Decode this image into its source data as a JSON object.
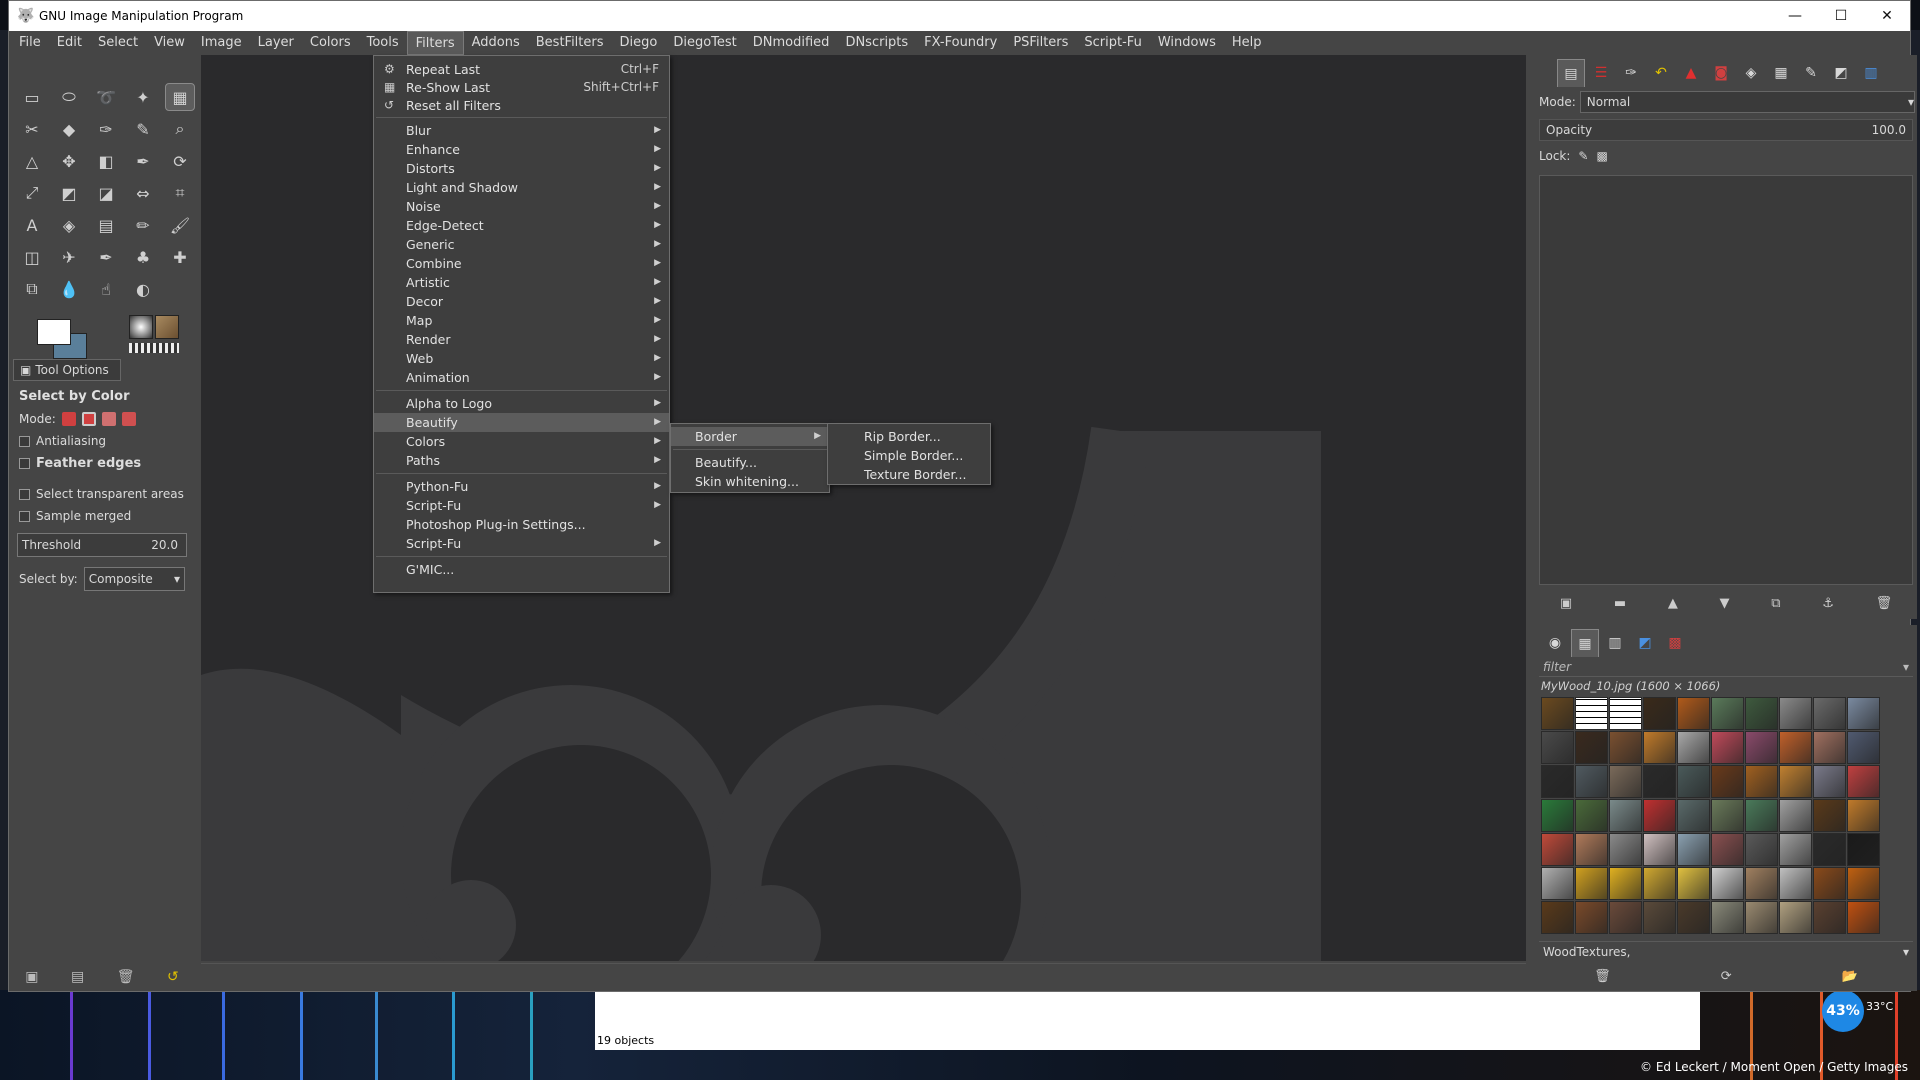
{
  "window": {
    "title": "GNU Image Manipulation Program",
    "controls": {
      "minimize": "—",
      "maximize": "☐",
      "close": "✕"
    }
  },
  "menubar": [
    {
      "label": "File"
    },
    {
      "label": "Edit"
    },
    {
      "label": "Select"
    },
    {
      "label": "View"
    },
    {
      "label": "Image"
    },
    {
      "label": "Layer"
    },
    {
      "label": "Colors"
    },
    {
      "label": "Tools"
    },
    {
      "label": "Filters"
    },
    {
      "label": "Addons"
    },
    {
      "label": "BestFilters"
    },
    {
      "label": "Diego"
    },
    {
      "label": "DiegoTest"
    },
    {
      "label": "DNmodified"
    },
    {
      "label": "DNscripts"
    },
    {
      "label": "FX-Foundry"
    },
    {
      "label": "PSFilters"
    },
    {
      "label": "Script-Fu"
    },
    {
      "label": "Windows"
    },
    {
      "label": "Help"
    }
  ],
  "filters_menu": {
    "top": [
      {
        "label": "Repeat Last",
        "shortcut": "Ctrl+F",
        "icon": "⚙"
      },
      {
        "label": "Re-Show Last",
        "shortcut": "Shift+Ctrl+F",
        "icon": "▦"
      },
      {
        "label": "Reset all Filters",
        "shortcut": "",
        "icon": "↺"
      }
    ],
    "groups": [
      {
        "label": "Blur"
      },
      {
        "label": "Enhance"
      },
      {
        "label": "Distorts"
      },
      {
        "label": "Light and Shadow"
      },
      {
        "label": "Noise"
      },
      {
        "label": "Edge-Detect"
      },
      {
        "label": "Generic"
      },
      {
        "label": "Combine"
      },
      {
        "label": "Artistic"
      },
      {
        "label": "Decor"
      },
      {
        "label": "Map"
      },
      {
        "label": "Render"
      },
      {
        "label": "Web"
      },
      {
        "label": "Animation"
      }
    ],
    "more": [
      {
        "label": "Alpha to Logo"
      },
      {
        "label": "Beautify"
      },
      {
        "label": "Colors"
      },
      {
        "label": "Paths"
      }
    ],
    "scripts": [
      {
        "label": "Python-Fu",
        "arrow": true
      },
      {
        "label": "Script-Fu",
        "arrow": true
      },
      {
        "label": "Photoshop Plug-in Settings...",
        "arrow": false
      },
      {
        "label": "Script-Fu",
        "arrow": true
      }
    ],
    "gmic": "G'MIC..."
  },
  "beautify_menu": [
    {
      "label": "Border"
    },
    {
      "label": "Beautify..."
    },
    {
      "label": "Skin whitening..."
    }
  ],
  "border_menu": [
    {
      "label": "Rip Border..."
    },
    {
      "label": "Simple Border..."
    },
    {
      "label": "Texture Border..."
    }
  ],
  "tool_options": {
    "tab_label": "Tool Options",
    "title": "Select by Color",
    "mode_label": "Mode:",
    "antialiasing": "Antialiasing",
    "feather": "Feather edges",
    "transparent": "Select transparent areas",
    "sample_merged": "Sample merged",
    "threshold_label": "Threshold",
    "threshold_value": "20.0",
    "select_by_label": "Select by:",
    "select_by_value": "Composite"
  },
  "layers": {
    "mode_label": "Mode:",
    "mode_value": "Normal",
    "opacity_label": "Opacity",
    "opacity_value": "100.0",
    "lock_label": "Lock:"
  },
  "patterns": {
    "filter_placeholder": "filter",
    "current": "MyWood_10.jpg (1600 × 1066)",
    "tag": "WoodTextures,"
  },
  "taskbar": {
    "objects": "19 objects",
    "badge": "43%",
    "temperature": "33°C",
    "copyright": "© Ed Leckert / Moment Open / Getty Images"
  },
  "colors": {
    "window_bg": "#454545",
    "canvas_bg": "#2a2a2c",
    "menu_bg": "#3e3e3e",
    "menu_highlight": "#5c5c5c",
    "accent_blue": "#1e88e5"
  },
  "pattern_colors": [
    "#6b4a1f",
    "#e8e8e8",
    "#f0f0f0",
    "#3a2a1a",
    "#b05a1a",
    "#5a7a5a",
    "#3e5a3e",
    "#8a8a8a",
    "#6a6a6a",
    "#7a8aa0",
    "#4a4a4a",
    "#3a2a1e",
    "#7a5030",
    "#c07a2a",
    "#a8a8a8",
    "#c04a5a",
    "#8a4a6a",
    "#c0602a",
    "#a07060",
    "#505a70",
    "#2a2a2a",
    "#505a60",
    "#7a6a5a",
    "#2a2a2a",
    "#4a5a5a",
    "#6a3a1a",
    "#a06020",
    "#c08030",
    "#7a7a8a",
    "#c04040",
    "#2a7a3a",
    "#4a6a3a",
    "#7a8a8a",
    "#c03030",
    "#5a6a6a",
    "#6a7a5a",
    "#4a7a5a",
    "#a0a0a0",
    "#5a3a1a",
    "#c07a2a",
    "#c04a3a",
    "#b07a5a",
    "#8a8a8a",
    "#d0c0c0",
    "#8aa0b0",
    "#8a5050",
    "#5a5a5a",
    "#a0a0a0",
    "#2a2a2a",
    "#1a1a1a",
    "#b0b0b0",
    "#d0a020",
    "#e0b020",
    "#d0a830",
    "#e0c040",
    "#d0d0d0",
    "#a08060",
    "#c0c0c0",
    "#8a4a1a",
    "#c06010",
    "#5a3a1a",
    "#7a4a2a",
    "#6a4a3a",
    "#5a4a3a",
    "#4a3a2a",
    "#8a8a7a",
    "#9a8a70",
    "#b0a080",
    "#5a4030",
    "#c05010"
  ]
}
